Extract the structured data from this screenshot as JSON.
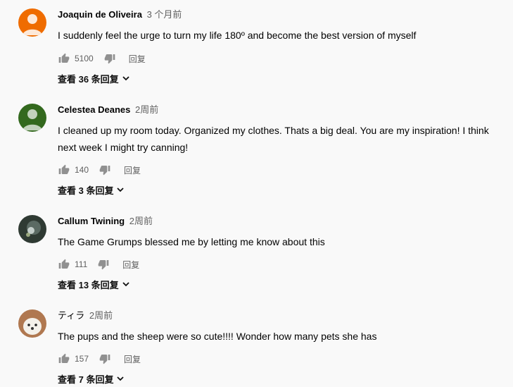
{
  "comments": [
    {
      "author": "Joaquin de Oliveira",
      "time": "3 个月前",
      "text": "I suddenly feel the urge to turn my life 180º and become the best version of myself",
      "likes": "5100",
      "reply_label": "回复",
      "view_replies": "查看 36 条回复",
      "avatar_color": "#ef6c00"
    },
    {
      "author": "Celestea Deanes",
      "time": "2周前",
      "text": "I cleaned up my room today. Organized my clothes. Thats a big deal. You are my inspiration! I think next week I might try canning!",
      "likes": "140",
      "reply_label": "回复",
      "view_replies": "查看 3 条回复",
      "avatar_color": "#33691e"
    },
    {
      "author": "Callum Twining",
      "time": "2周前",
      "text": "The Game Grumps blessed me by letting me know about this",
      "likes": "111",
      "reply_label": "回复",
      "view_replies": "查看 13 条回复",
      "avatar_color": "#2f3a33"
    },
    {
      "author": "ティラ",
      "time": "2周前",
      "text": "The pups and the sheep were so cute!!!! Wonder how many pets she has",
      "likes": "157",
      "reply_label": "回复",
      "view_replies": "查看 7 条回复",
      "avatar_color": "#b07850"
    }
  ]
}
